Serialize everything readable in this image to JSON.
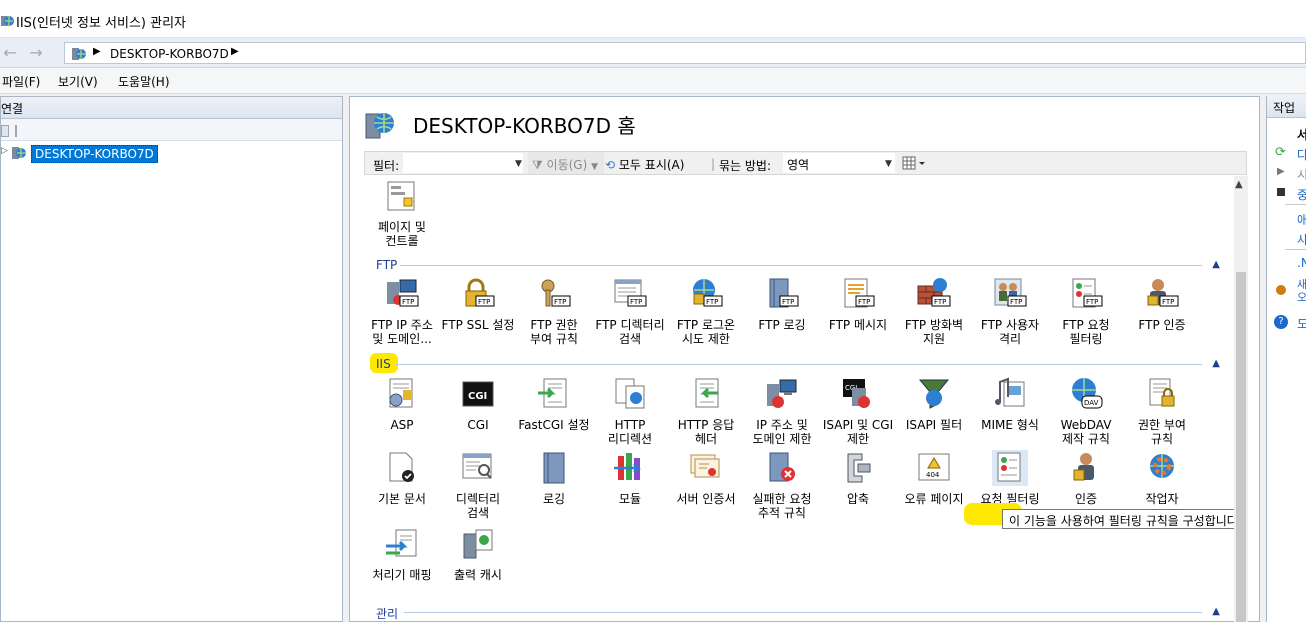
{
  "window": {
    "title": "IIS(인터넷 정보 서비스) 관리자"
  },
  "address": {
    "path": "DESKTOP-KORBO7D"
  },
  "menu": {
    "file": "파일(F)",
    "view": "보기(V)",
    "help": "도움말(H)"
  },
  "connections": {
    "header": "연결",
    "server": "DESKTOP-KORBO7D"
  },
  "home": {
    "title": "DESKTOP-KORBO7D 홈"
  },
  "filterbar": {
    "filter_label": "필터:",
    "go_label": "이동(G)",
    "showall_label": "모두 표시(A)",
    "groupby_label": "묶는 방법:",
    "groupby_value": "영역"
  },
  "groups": {
    "ftp": "FTP",
    "iis": "IIS",
    "mgmt": "관리"
  },
  "features": {
    "top": [
      {
        "label": "페이지 및\n컨트롤"
      }
    ],
    "ftp": [
      {
        "label": "FTP IP 주소\n및 도메인..."
      },
      {
        "label": "FTP SSL 설정"
      },
      {
        "label": "FTP 권한\n부여 규칙"
      },
      {
        "label": "FTP 디렉터리\n검색"
      },
      {
        "label": "FTP 로그온\n시도 제한"
      },
      {
        "label": "FTP 로깅"
      },
      {
        "label": "FTP 메시지"
      },
      {
        "label": "FTP 방화벽\n지원"
      },
      {
        "label": "FTP 사용자\n격리"
      },
      {
        "label": "FTP 요청\n필터링"
      },
      {
        "label": "FTP 인증"
      }
    ],
    "iis_row1": [
      {
        "label": "ASP"
      },
      {
        "label": "CGI"
      },
      {
        "label": "FastCGI 설정"
      },
      {
        "label": "HTTP\n리디렉션"
      },
      {
        "label": "HTTP 응답\n헤더"
      },
      {
        "label": "IP 주소 및\n도메인 제한"
      },
      {
        "label": "ISAPI 및 CGI\n제한"
      },
      {
        "label": "ISAPI 필터"
      },
      {
        "label": "MIME 형식"
      },
      {
        "label": "WebDAV\n제작 규칙"
      },
      {
        "label": "권한 부여\n규칙"
      }
    ],
    "iis_row2": [
      {
        "label": "기본 문서"
      },
      {
        "label": "디렉터리\n검색"
      },
      {
        "label": "로깅"
      },
      {
        "label": "모듈"
      },
      {
        "label": "서버 인증서"
      },
      {
        "label": "실패한 요청\n추적 규칙"
      },
      {
        "label": "압축"
      },
      {
        "label": "오류 페이지"
      },
      {
        "label": "요청 필터링"
      },
      {
        "label": "인증"
      },
      {
        "label": "작업자"
      }
    ],
    "iis_row3": [
      {
        "label": "처리기 매핑"
      },
      {
        "label": "출력 캐시"
      }
    ]
  },
  "tooltip": "이 기능을 사용하여 필터링 규칙을 구성합니다.",
  "actions": {
    "header": "작업",
    "items": [
      "서",
      "다",
      "시",
      "중",
      "애",
      "사",
      ".N",
      "새\n오",
      "도"
    ]
  },
  "colors": {
    "selection": "#0078d7",
    "highlight": "#ffe800",
    "link": "#1b6ac9"
  }
}
